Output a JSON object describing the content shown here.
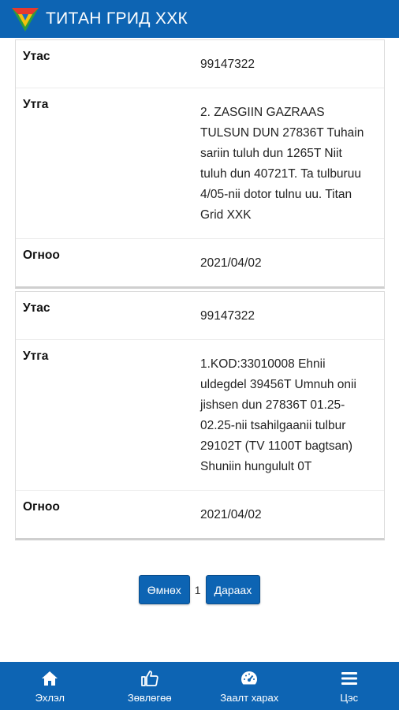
{
  "header": {
    "title": "ТИТАН ГРИД ХХК"
  },
  "messages": [
    {
      "phone_label": "Утас",
      "phone": "99147322",
      "text_label": "Утга",
      "text": "2. ZASGIIN GAZRAAS TULSUN DUN 27836T Tuhain sariin tuluh dun 1265T Niit tuluh dun 40721T. Ta tulburuu 4/05-nii dotor tulnu uu. Titan Grid XXK",
      "date_label": "Огноо",
      "date": "2021/04/02"
    },
    {
      "phone_label": "Утас",
      "phone": "99147322",
      "text_label": "Утга",
      "text": "1.KOD:33010008 Ehnii uldegdel 39456T Umnuh onii jishsen dun 27836T 01.25-02.25-nii tsahilgaanii tulbur 29102T (TV 1100T bagtsan) Shuniin hungulult 0T",
      "date_label": "Огноо",
      "date": "2021/04/02"
    }
  ],
  "pagination": {
    "prev_label": "Өмнөх",
    "current_page": "1",
    "next_label": "Дараах"
  },
  "bottom_nav": [
    {
      "label": "Эхлэл",
      "icon": "home-icon"
    },
    {
      "label": "Зөвлөгөө",
      "icon": "thumbs-up-icon"
    },
    {
      "label": "Заалт харах",
      "icon": "speedometer-icon"
    },
    {
      "label": "Цэс",
      "icon": "menu-icon"
    }
  ],
  "colors": {
    "primary": "#0d64b3",
    "background": "#ffffff"
  }
}
